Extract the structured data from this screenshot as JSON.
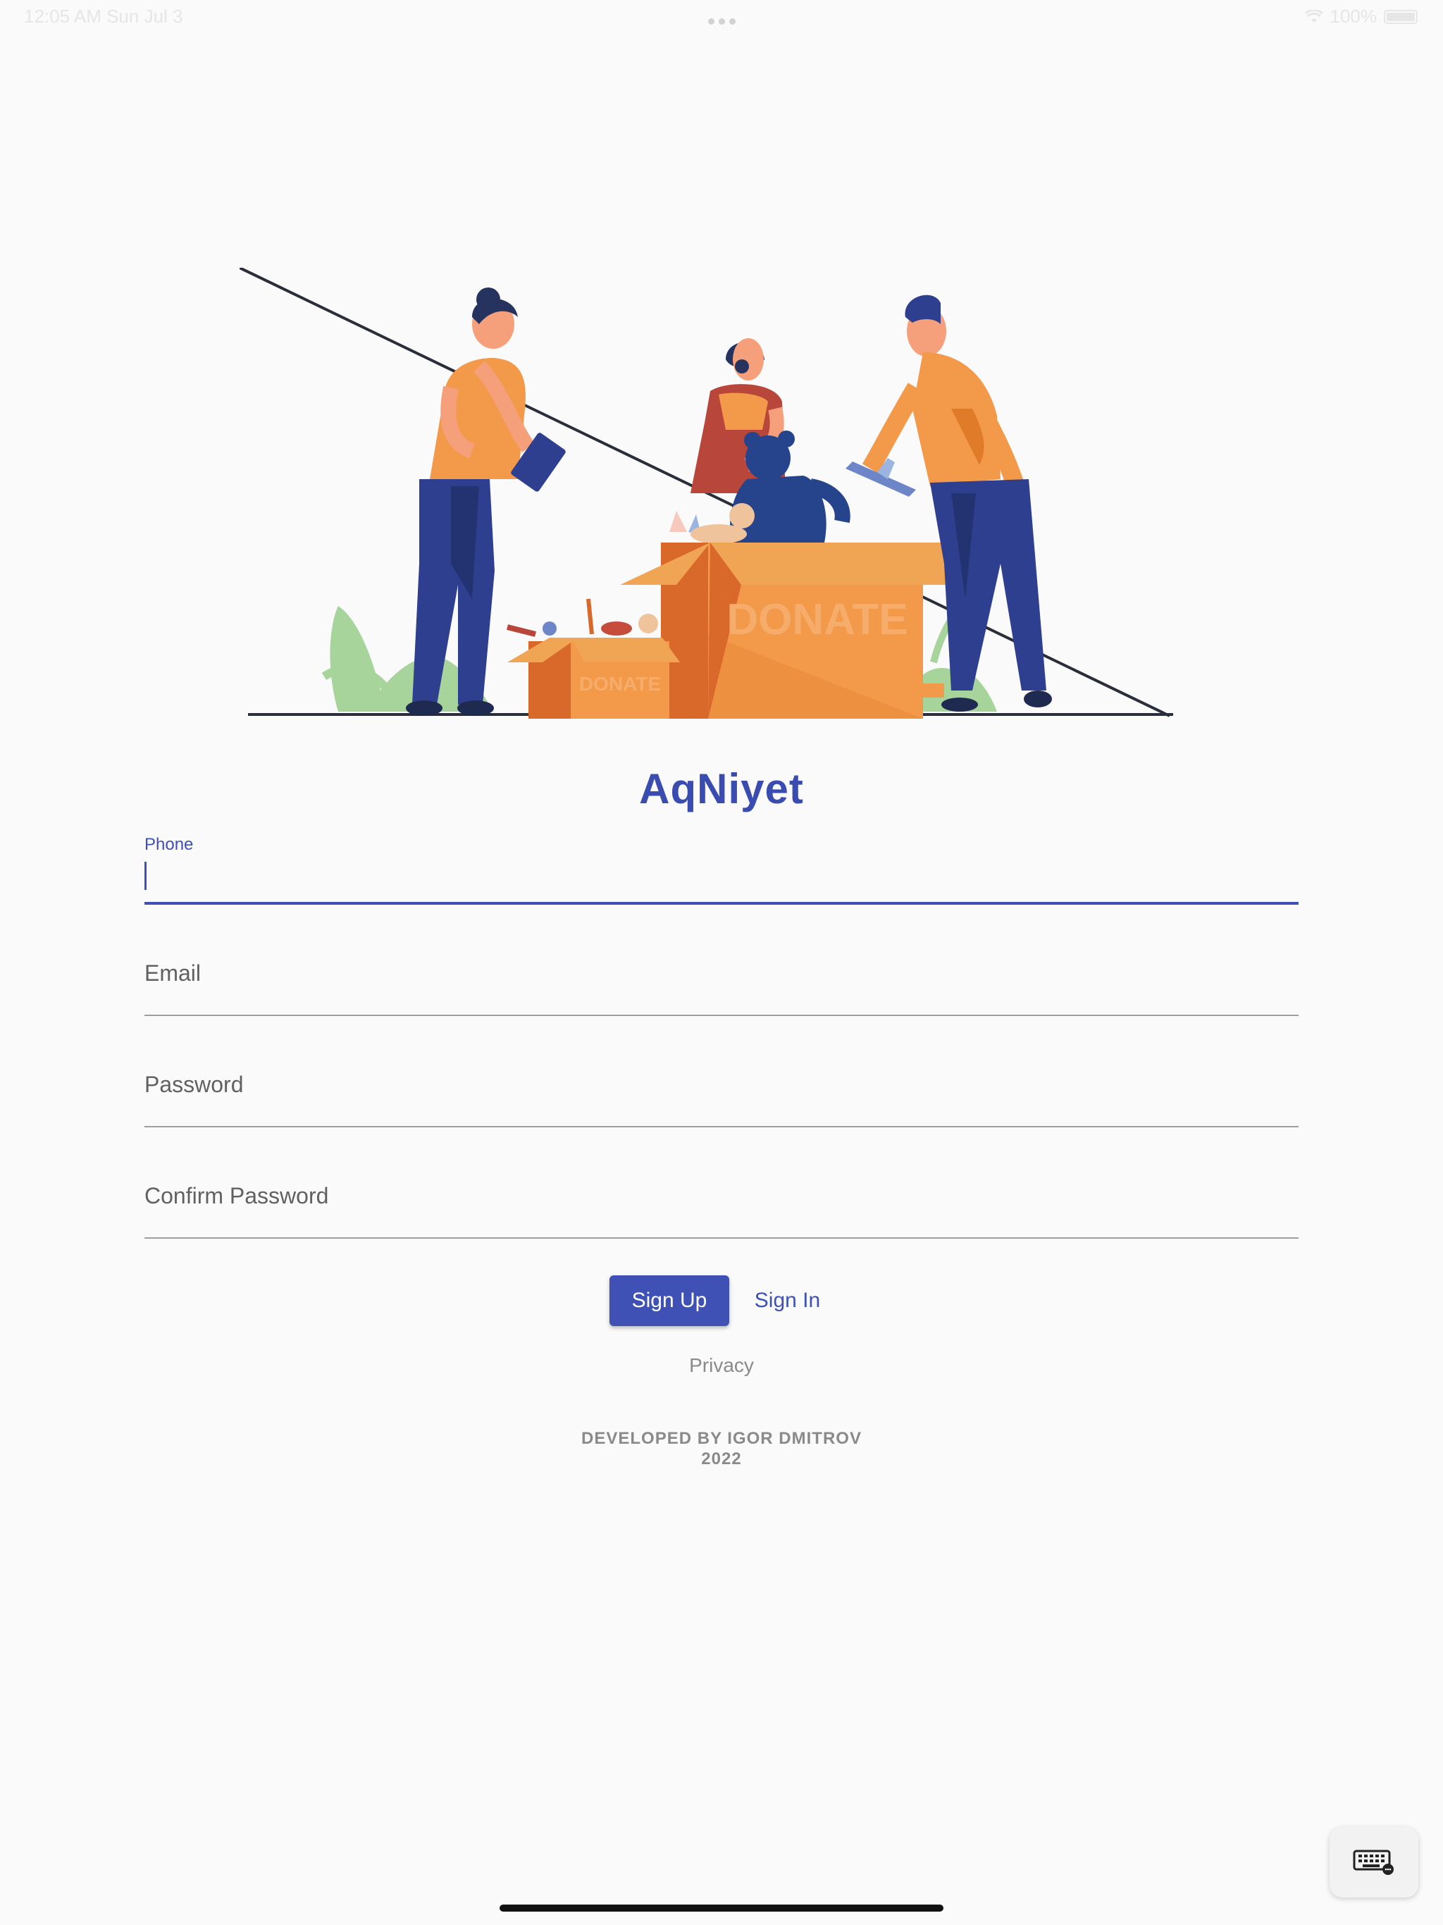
{
  "status_bar": {
    "time": "12:05 AM",
    "date": "Sun Jul 3",
    "battery": "100%"
  },
  "illustration": {
    "big_box_label": "DONATE",
    "small_box_label": "DONATE"
  },
  "app": {
    "title": "AqNiyet"
  },
  "form": {
    "phone": {
      "label": "Phone",
      "value": ""
    },
    "email": {
      "label": "Email",
      "value": ""
    },
    "password": {
      "label": "Password",
      "value": ""
    },
    "confirm_password": {
      "label": "Confirm Password",
      "value": ""
    }
  },
  "actions": {
    "signup_label": "Sign Up",
    "signin_label": "Sign In",
    "privacy_label": "Privacy"
  },
  "footer": {
    "developer": "DEVELOPED BY IGOR DMITROV",
    "year": "2022"
  },
  "colors": {
    "primary": "#3f51b5",
    "orange": "#f2994a",
    "navy": "#2f3f8f",
    "background": "#fafafa"
  },
  "icons": {
    "keyboard": "keyboard-icon",
    "wifi": "wifi-icon",
    "battery": "battery-icon"
  }
}
